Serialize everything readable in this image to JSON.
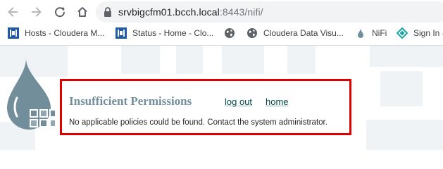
{
  "browser": {
    "url_host": "srvbigcfm01.bcch.local",
    "url_rest": ":8443/nifi/"
  },
  "bookmarks": [
    {
      "label": "Hosts - Cloudera M...",
      "icon": "cloudera-manager-icon"
    },
    {
      "label": "Status - Home - Clo...",
      "icon": "cloudera-manager-icon"
    },
    {
      "label": "",
      "icon": "globe-icon"
    },
    {
      "label": "Cloudera Data Visu...",
      "icon": "globe-icon"
    },
    {
      "label": "NiFi",
      "icon": "nifi-drop-icon"
    },
    {
      "label": "Sign In -",
      "icon": "sign-in-icon"
    }
  ],
  "colors": {
    "error_border": "#e00000",
    "title": "#728e9b",
    "link": "#004849",
    "logo": "#728e9b"
  },
  "message": {
    "title": "Insufficient Permissions",
    "logout_label": "log out",
    "home_label": "home",
    "body": "No applicable policies could be found. Contact the system administrator."
  }
}
